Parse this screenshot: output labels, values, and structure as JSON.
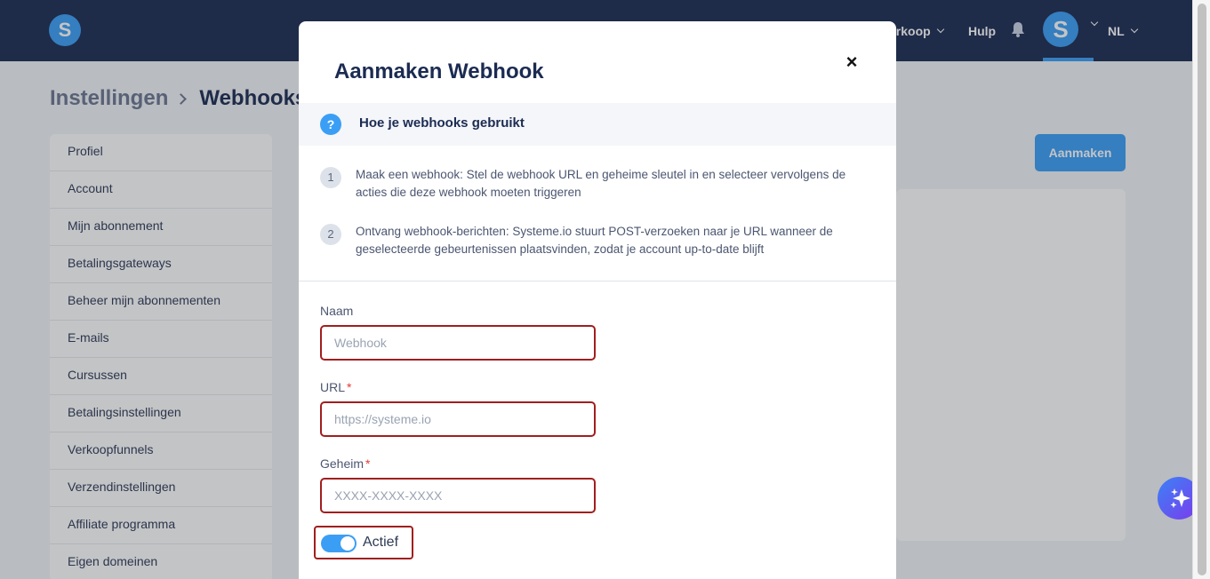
{
  "topnav": {
    "sales_label": "erkoop",
    "help_label": "Hulp",
    "avatar_letter": "S",
    "lang_label": "NL",
    "logo_letter": "S"
  },
  "breadcrumb": {
    "parent": "Instellingen",
    "current": "Webhooks"
  },
  "sidebar": {
    "items": [
      {
        "label": "Profiel"
      },
      {
        "label": "Account"
      },
      {
        "label": "Mijn abonnement"
      },
      {
        "label": "Betalingsgateways"
      },
      {
        "label": "Beheer mijn abonnementen"
      },
      {
        "label": "E-mails"
      },
      {
        "label": "Cursussen"
      },
      {
        "label": "Betalingsinstellingen"
      },
      {
        "label": "Verkoopfunnels"
      },
      {
        "label": "Verzendinstellingen"
      },
      {
        "label": "Affiliate programma"
      },
      {
        "label": "Eigen domeinen"
      }
    ]
  },
  "main": {
    "create_button": "Aanmaken"
  },
  "modal": {
    "title": "Aanmaken Webhook",
    "help_title": "Hoe je webhooks gebruikt",
    "help_icon": "?",
    "steps": [
      {
        "num": "1",
        "text": "Maak een webhook: Stel de webhook URL en geheime sleutel in en selecteer vervolgens de acties die deze webhook moeten triggeren"
      },
      {
        "num": "2",
        "text": "Ontvang webhook-berichten: Systeme.io stuurt POST-verzoeken naar je URL wanneer de geselecteerde gebeurtenissen plaatsvinden, zodat je account up-to-date blijft"
      }
    ],
    "fields": {
      "name": {
        "label": "Naam",
        "placeholder": "Webhook",
        "value": ""
      },
      "url": {
        "label": "URL",
        "required_mark": "*",
        "placeholder": "https://systeme.io",
        "value": ""
      },
      "secret": {
        "label": "Geheim",
        "required_mark": "*",
        "placeholder": "XXXX-XXXX-XXXX",
        "value": ""
      }
    },
    "active_toggle": {
      "label": "Actief",
      "on": true
    }
  },
  "colors": {
    "nav_bg": "#1b2b52",
    "accent": "#3b9ef5",
    "highlight_border": "#a11e1e"
  }
}
